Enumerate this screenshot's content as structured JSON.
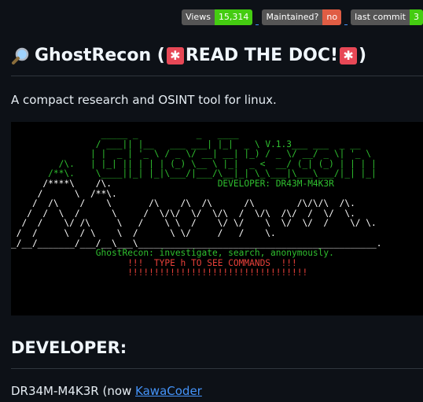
{
  "badges": [
    {
      "label": "Views",
      "value": "15,314",
      "color": "#4c1"
    },
    {
      "label": "Maintained?",
      "value": "no",
      "color": "#e05d44"
    },
    {
      "label": "last commit",
      "value": "3",
      "color": "#4c1"
    }
  ],
  "title": {
    "icon": "magnifying-glass-icon",
    "name": "GhostRecon (",
    "siren_icon": "siren-icon",
    "notice": "READ THE DOC!",
    "close": ")"
  },
  "description": "A compact research and OSINT tool for linux.",
  "banner": {
    "version": "V.1.3",
    "developer_line": "DEVELOPER: DR43M-M4K3R",
    "tagline": "GhostRecon: investigate, search, anonymously.",
    "warning": "!!!  TYPE h TO SEE COMMANDS  !!!",
    "bangs": "!!!!!!!!!!!!!!!!!!!!!!!!!!!!!!!!!!"
  },
  "developer_heading": "DEVELOPER:",
  "developer": {
    "prefix": "DR34M-M4K3R (now ",
    "link": "KawaCoder"
  },
  "colors": {
    "background": "#0d1117",
    "text": "#e6edf3",
    "link": "#4493f8",
    "banner_green": "#2fbf2f",
    "banner_red": "#e8403a"
  }
}
